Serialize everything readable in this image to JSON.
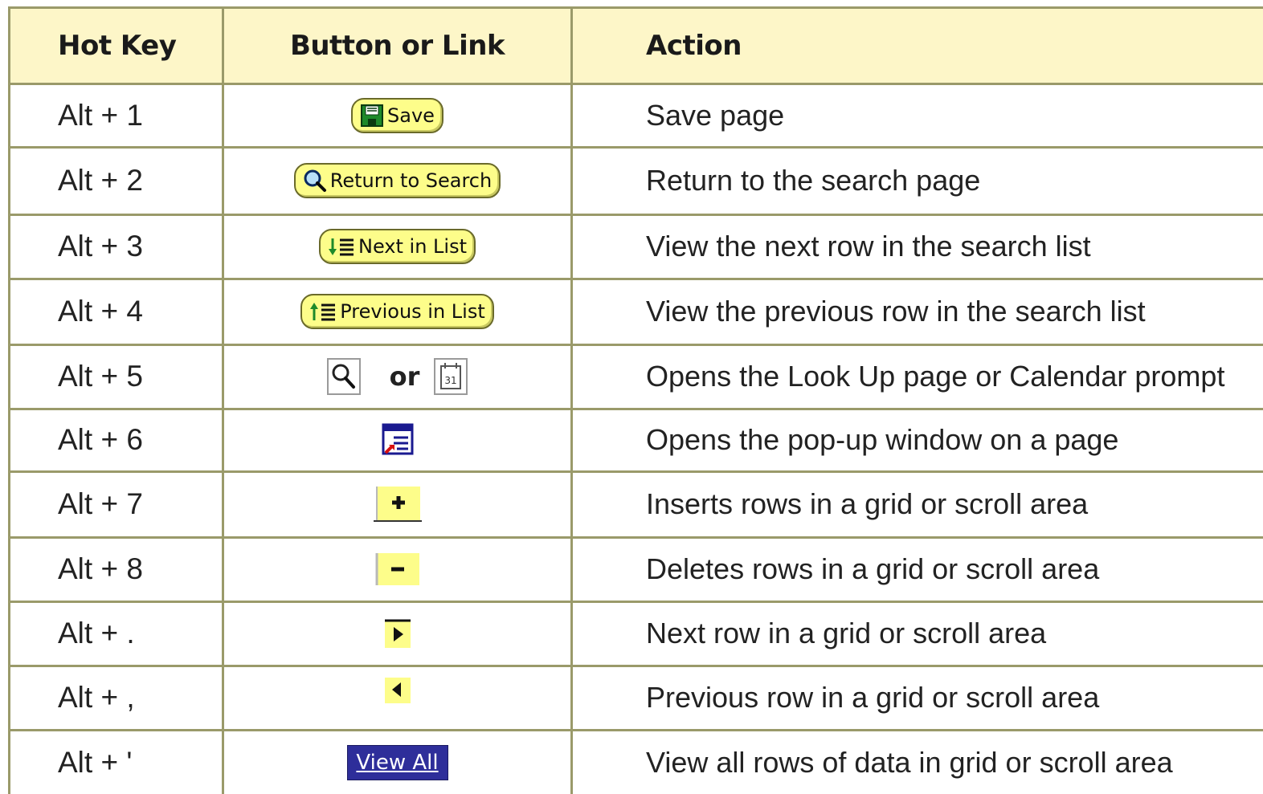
{
  "headers": {
    "hotkey": "Hot Key",
    "button": "Button or Link",
    "action": "Action"
  },
  "rows": [
    {
      "hotkey": "Alt + 1",
      "button_label": "Save",
      "button_icon": "floppy-disk-icon",
      "action": "Save page"
    },
    {
      "hotkey": "Alt + 2",
      "button_label": "Return to Search",
      "button_icon": "magnifier-icon",
      "action": "Return to the search page"
    },
    {
      "hotkey": "Alt + 3",
      "button_label": "Next in List",
      "button_icon": "down-arrow-list-icon",
      "action": "View the next row in the search list"
    },
    {
      "hotkey": "Alt + 4",
      "button_label": "Previous in List",
      "button_icon": "up-arrow-list-icon",
      "action": "View the previous row in the search list"
    },
    {
      "hotkey": "Alt + 5",
      "button_label": "or",
      "button_icon": "lookup-and-calendar-icons",
      "action": "Opens the Look Up page or Calendar prompt"
    },
    {
      "hotkey": "Alt + 6",
      "button_icon": "popup-window-icon",
      "action": "Opens the pop-up window on a page"
    },
    {
      "hotkey": "Alt + 7",
      "button_icon": "insert-row-plus-icon",
      "action": "Inserts rows in a grid or scroll area"
    },
    {
      "hotkey": "Alt + 8",
      "button_icon": "delete-row-minus-icon",
      "action": "Deletes rows in a grid or scroll area"
    },
    {
      "hotkey": "Alt + .",
      "button_icon": "next-row-arrow-icon",
      "action": "Next row in a grid or scroll area"
    },
    {
      "hotkey": "Alt + ,",
      "button_icon": "previous-row-arrow-icon",
      "action": "Previous row in a grid or scroll area"
    },
    {
      "hotkey": "Alt + '",
      "button_label": "View All",
      "button_icon": "view-all-link",
      "action": "View all rows of data in grid or scroll area"
    }
  ],
  "colors": {
    "header_bg": "#fdf6c8",
    "grid_line": "#9a9a6a",
    "button_yellow": "#fdfd8a",
    "view_all_bg": "#2e2e9a"
  }
}
